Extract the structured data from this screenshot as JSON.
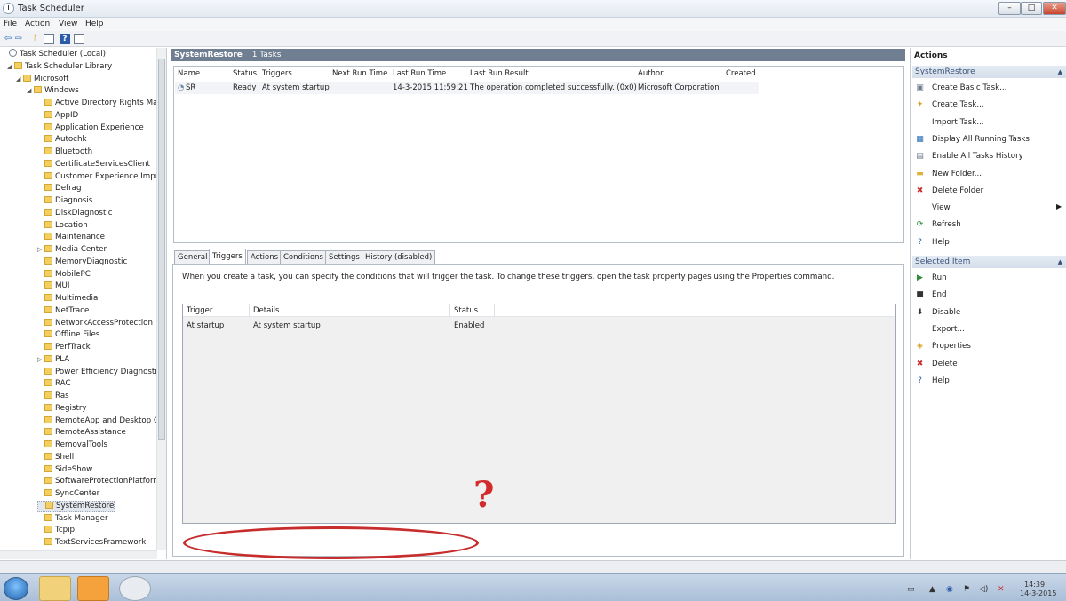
{
  "window": {
    "title": "Task Scheduler"
  },
  "menu": [
    "File",
    "Action",
    "View",
    "Help"
  ],
  "tree": [
    {
      "label": "Task Scheduler (Local)",
      "indent": 0,
      "icon": "clock-icon",
      "expander": ""
    },
    {
      "label": "Task Scheduler Library",
      "indent": 1,
      "icon": "folder-icon",
      "expander": "◢"
    },
    {
      "label": "Microsoft",
      "indent": 2,
      "icon": "folder-icon",
      "expander": "◢"
    },
    {
      "label": "Windows",
      "indent": 3,
      "icon": "folder-icon",
      "expander": "◢"
    },
    {
      "label": "Active Directory Rights Ma",
      "indent": 4,
      "icon": "folder-icon",
      "expander": ""
    },
    {
      "label": "AppID",
      "indent": 4,
      "icon": "folder-icon",
      "expander": ""
    },
    {
      "label": "Application Experience",
      "indent": 4,
      "icon": "folder-icon",
      "expander": ""
    },
    {
      "label": "Autochk",
      "indent": 4,
      "icon": "folder-icon",
      "expander": ""
    },
    {
      "label": "Bluetooth",
      "indent": 4,
      "icon": "folder-icon",
      "expander": ""
    },
    {
      "label": "CertificateServicesClient",
      "indent": 4,
      "icon": "folder-icon",
      "expander": ""
    },
    {
      "label": "Customer Experience Impr",
      "indent": 4,
      "icon": "folder-icon",
      "expander": ""
    },
    {
      "label": "Defrag",
      "indent": 4,
      "icon": "folder-icon",
      "expander": ""
    },
    {
      "label": "Diagnosis",
      "indent": 4,
      "icon": "folder-icon",
      "expander": ""
    },
    {
      "label": "DiskDiagnostic",
      "indent": 4,
      "icon": "folder-icon",
      "expander": ""
    },
    {
      "label": "Location",
      "indent": 4,
      "icon": "folder-icon",
      "expander": ""
    },
    {
      "label": "Maintenance",
      "indent": 4,
      "icon": "folder-icon",
      "expander": ""
    },
    {
      "label": "Media Center",
      "indent": 4,
      "icon": "folder-icon",
      "expander": "▷"
    },
    {
      "label": "MemoryDiagnostic",
      "indent": 4,
      "icon": "folder-icon",
      "expander": ""
    },
    {
      "label": "MobilePC",
      "indent": 4,
      "icon": "folder-icon",
      "expander": ""
    },
    {
      "label": "MUI",
      "indent": 4,
      "icon": "folder-icon",
      "expander": ""
    },
    {
      "label": "Multimedia",
      "indent": 4,
      "icon": "folder-icon",
      "expander": ""
    },
    {
      "label": "NetTrace",
      "indent": 4,
      "icon": "folder-icon",
      "expander": ""
    },
    {
      "label": "NetworkAccessProtection",
      "indent": 4,
      "icon": "folder-icon",
      "expander": ""
    },
    {
      "label": "Offline Files",
      "indent": 4,
      "icon": "folder-icon",
      "expander": ""
    },
    {
      "label": "PerfTrack",
      "indent": 4,
      "icon": "folder-icon",
      "expander": ""
    },
    {
      "label": "PLA",
      "indent": 4,
      "icon": "folder-icon",
      "expander": "▷"
    },
    {
      "label": "Power Efficiency Diagnosti",
      "indent": 4,
      "icon": "folder-icon",
      "expander": ""
    },
    {
      "label": "RAC",
      "indent": 4,
      "icon": "folder-icon",
      "expander": ""
    },
    {
      "label": "Ras",
      "indent": 4,
      "icon": "folder-icon",
      "expander": ""
    },
    {
      "label": "Registry",
      "indent": 4,
      "icon": "folder-icon",
      "expander": ""
    },
    {
      "label": "RemoteApp and Desktop C",
      "indent": 4,
      "icon": "folder-icon",
      "expander": ""
    },
    {
      "label": "RemoteAssistance",
      "indent": 4,
      "icon": "folder-icon",
      "expander": ""
    },
    {
      "label": "RemovalTools",
      "indent": 4,
      "icon": "folder-icon",
      "expander": ""
    },
    {
      "label": "Shell",
      "indent": 4,
      "icon": "folder-icon",
      "expander": ""
    },
    {
      "label": "SideShow",
      "indent": 4,
      "icon": "folder-icon",
      "expander": ""
    },
    {
      "label": "SoftwareProtectionPlatform",
      "indent": 4,
      "icon": "folder-icon",
      "expander": ""
    },
    {
      "label": "SyncCenter",
      "indent": 4,
      "icon": "folder-icon",
      "expander": ""
    },
    {
      "label": "SystemRestore",
      "indent": 4,
      "icon": "folder-icon",
      "expander": "",
      "selected": true
    },
    {
      "label": "Task Manager",
      "indent": 4,
      "icon": "folder-icon",
      "expander": ""
    },
    {
      "label": "Tcpip",
      "indent": 4,
      "icon": "folder-icon",
      "expander": ""
    },
    {
      "label": "TextServicesFramework",
      "indent": 4,
      "icon": "folder-icon",
      "expander": ""
    }
  ],
  "center": {
    "header_title": "SystemRestore",
    "header_count": "1 Tasks",
    "columns": [
      "Name",
      "Status",
      "Triggers",
      "Next Run Time",
      "Last Run Time",
      "Last Run Result",
      "Author",
      "Created"
    ],
    "row": [
      "SR",
      "Ready",
      "At system startup",
      "",
      "14-3-2015 11:59:21",
      "The operation completed successfully. (0x0)",
      "Microsoft Corporation",
      ""
    ]
  },
  "detail": {
    "tabs": [
      "General",
      "Triggers",
      "Actions",
      "Conditions",
      "Settings",
      "History (disabled)"
    ],
    "active_tab": "Triggers",
    "description": "When you create a task, you can specify the conditions that will trigger the task.  To change these triggers, open the task property pages using the Properties command.",
    "trigger_columns": [
      "Trigger",
      "Details",
      "Status"
    ],
    "trigger_row": [
      "At startup",
      "At system startup",
      "Enabled"
    ],
    "annotation_mark": "?"
  },
  "actions": {
    "title": "Actions",
    "section1": "SystemRestore",
    "section1_items": [
      {
        "label": "Create Basic Task...",
        "icon": "create-basic-task-icon"
      },
      {
        "label": "Create Task...",
        "icon": "create-task-icon"
      },
      {
        "label": "Import Task...",
        "icon": ""
      },
      {
        "label": "Display All Running Tasks",
        "icon": "running-tasks-icon"
      },
      {
        "label": "Enable All Tasks History",
        "icon": "history-icon"
      },
      {
        "label": "New Folder...",
        "icon": "new-folder-icon"
      },
      {
        "label": "Delete Folder",
        "icon": "delete-folder-icon"
      },
      {
        "label": "View",
        "icon": ""
      },
      {
        "label": "Refresh",
        "icon": "refresh-icon"
      },
      {
        "label": "Help",
        "icon": "help-icon"
      }
    ],
    "section2": "Selected Item",
    "section2_items": [
      {
        "label": "Run",
        "icon": "run-icon"
      },
      {
        "label": "End",
        "icon": "end-icon"
      },
      {
        "label": "Disable",
        "icon": "disable-icon"
      },
      {
        "label": "Export...",
        "icon": ""
      },
      {
        "label": "Properties",
        "icon": "properties-icon"
      },
      {
        "label": "Delete",
        "icon": "delete-icon"
      },
      {
        "label": "Help",
        "icon": "help-icon"
      }
    ]
  },
  "taskbar": {
    "time": "14:39",
    "date": "14-3-2015"
  },
  "colors": {
    "header_bg": "#6f7e90",
    "section_bg": "#d5deea",
    "annotation": "#c82d2d"
  }
}
